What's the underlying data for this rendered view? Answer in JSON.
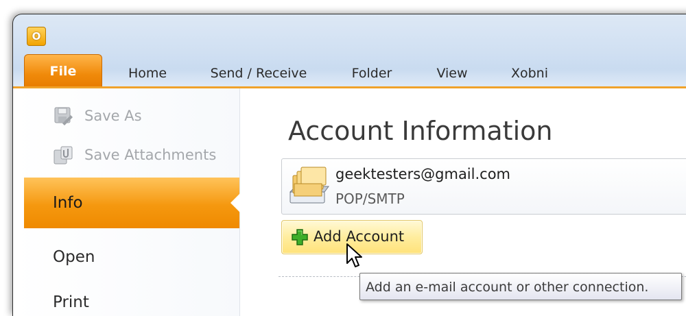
{
  "app": {
    "icon_letter": "O",
    "icon": "outlook-icon"
  },
  "ribbon": {
    "tabs": [
      {
        "label": "File",
        "active": true
      },
      {
        "label": "Home"
      },
      {
        "label": "Send / Receive"
      },
      {
        "label": "Folder"
      },
      {
        "label": "View"
      },
      {
        "label": "Xobni"
      }
    ],
    "accent_color": "#f08a0a"
  },
  "backstage_nav": {
    "items": [
      {
        "label": "Save As",
        "icon": "save-as-icon",
        "disabled": true
      },
      {
        "label": "Save Attachments",
        "icon": "save-attachments-icon",
        "disabled": true
      },
      {
        "label": "Info",
        "selected": true
      },
      {
        "label": "Open"
      },
      {
        "label": "Print"
      }
    ]
  },
  "account_info": {
    "heading": "Account Information",
    "account": {
      "email": "geektesters@gmail.com",
      "type": "POP/SMTP",
      "icon": "account-folder-icon"
    },
    "add_account_label": "Add Account",
    "add_icon": "green-plus-icon"
  },
  "tooltip": {
    "text": "Add an e-mail account or other connection."
  }
}
